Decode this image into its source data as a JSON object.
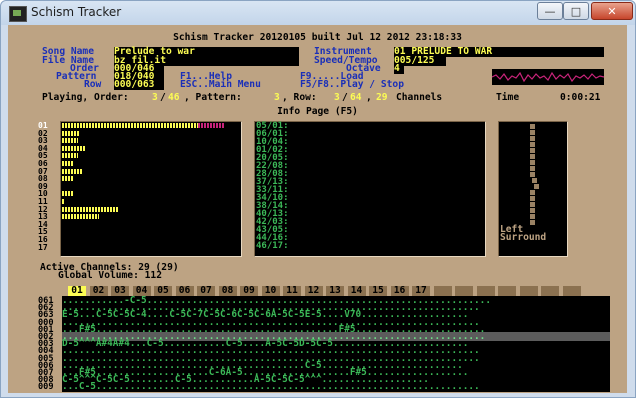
{
  "window": {
    "title": "Schism Tracker",
    "min_label": "—",
    "max_label": "□",
    "close_label": "✕"
  },
  "header": {
    "version": "Schism Tracker 20120105 built Jul 12 2012 23:18:33"
  },
  "info": {
    "song_name_label": "Song Name",
    "song_name": "Prelude to war",
    "file_name_label": "File Name",
    "file_name": "bz_fil.it",
    "order_label": "Order",
    "order": "000/046",
    "pattern_label": "Pattern",
    "pattern": "018/040",
    "row_label": "Row",
    "row": "000/063",
    "instrument_label": "Instrument",
    "instrument": "01 PRELUDE TO WAR",
    "speed_label": "Speed/Tempo",
    "speed": "005/125",
    "octave_label": "Octave",
    "octave": "4",
    "help1": "F1...Help",
    "help2": "ESC..Main Menu",
    "help3": "F9.....Load",
    "help4": "F5/F8..Play / Stop"
  },
  "status": {
    "playing": "Playing, Order:",
    "order_cur": "3",
    "order_tot": "46",
    "pattern_lbl": ", Pattern:",
    "pattern_cur": "3",
    "row_lbl": ", Row:",
    "row_cur": "3",
    "row_tot": "64",
    "channels_cnt": "29",
    "channels_lbl": "Channels",
    "time_lbl": "Time",
    "time": "0:00:21"
  },
  "page_title": "Info Page (F5)",
  "sample_rows": [
    {
      "n": "01",
      "bar": 0.78
    },
    {
      "n": "02",
      "bar": 0.1
    },
    {
      "n": "03",
      "bar": 0.09
    },
    {
      "n": "04",
      "bar": 0.14
    },
    {
      "n": "05",
      "bar": 0.09
    },
    {
      "n": "06",
      "bar": 0.07
    },
    {
      "n": "07",
      "bar": 0.12
    },
    {
      "n": "08",
      "bar": 0.07
    },
    {
      "n": "09",
      "bar": 0.0
    },
    {
      "n": "10",
      "bar": 0.07
    },
    {
      "n": "11",
      "bar": 0.02
    },
    {
      "n": "12",
      "bar": 0.33
    },
    {
      "n": "13",
      "bar": 0.21
    },
    {
      "n": "14",
      "bar": 0.0
    },
    {
      "n": "15",
      "bar": 0.0
    },
    {
      "n": "16",
      "bar": 0.0
    },
    {
      "n": "17",
      "bar": 0.0
    }
  ],
  "track_list": [
    "05/01:",
    "06/01:",
    "10/04:",
    "01/02:",
    "20/05:",
    "22/08:",
    "28/08:",
    "37/13:",
    "33/11:",
    "34/10:",
    "38/14:",
    "40/13:",
    "42/03:",
    "43/05:",
    "44/16:",
    "46/17:"
  ],
  "panning": {
    "left": "Left",
    "surround": "Surround"
  },
  "active_channels": "Active Channels: 29 (29)",
  "global_volume": "Global Volume: 112",
  "channel_numbers": [
    "01",
    "02",
    "03",
    "04",
    "05",
    "06",
    "07",
    "08",
    "09",
    "10",
    "11",
    "12",
    "13",
    "14",
    "15",
    "16",
    "17"
  ],
  "pattern_rows": [
    {
      "n": "061",
      "text": "...........-C-5............................................................."
    },
    {
      "n": "062",
      "text": ".........................................................................."
    },
    {
      "n": "063",
      "text": "E-5...C-5C-5C-4....C-5C-7C-5C-6C-5C-6A-5C-5E-5....V70..................."
    },
    {
      "n": "000",
      "text": ".........................................................................."
    },
    {
      "n": "001",
      "text": "...F#5...........................................F#5......................."
    },
    {
      "n": "002",
      "text": "...........................................................................",
      "hl": true
    },
    {
      "n": "003",
      "text": "D-5^^^A#4A#4...C-5...........C-5....A-5C-5D-5C-5........................"
    },
    {
      "n": "004",
      "text": ".........................................................................."
    },
    {
      "n": "005",
      "text": ".........................................................................."
    },
    {
      "n": "006",
      "text": "...........................................C-5........................."
    },
    {
      "n": "007",
      "text": "...F#5....................C-6A-5...................F#5.................."
    },
    {
      "n": "008",
      "text": "C-5^^^C-5C-5........C-5...........A-5C-5C-5^^^..................."
    },
    {
      "n": "009",
      "text": "...C-5...................................................................."
    }
  ]
}
